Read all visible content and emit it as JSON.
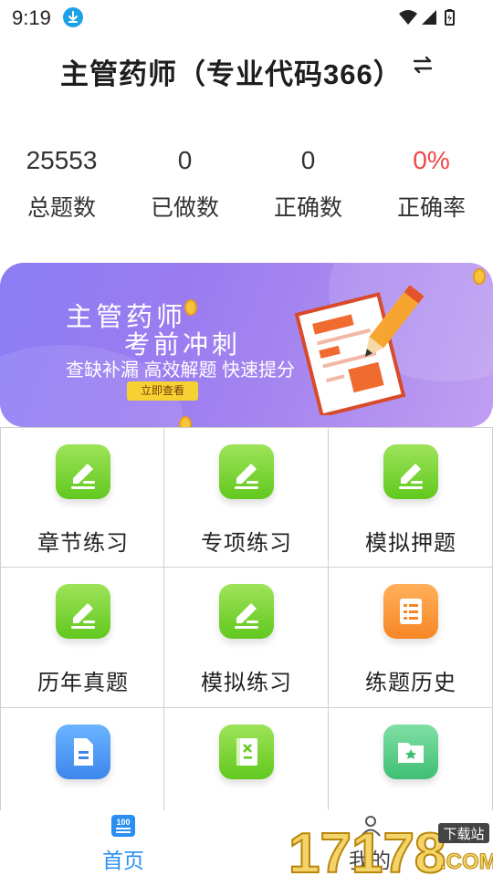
{
  "status_bar": {
    "time": "9:19"
  },
  "header": {
    "title": "主管药师（专业代码366）"
  },
  "stats": [
    {
      "value": "25553",
      "label": "总题数",
      "color": "#333333"
    },
    {
      "value": "0",
      "label": "已做数",
      "color": "#333333"
    },
    {
      "value": "0",
      "label": "正确数",
      "color": "#333333"
    },
    {
      "value": "0%",
      "label": "正确率",
      "color": "#f04747"
    }
  ],
  "banner": {
    "line1": "主管药师",
    "line2": "考前冲刺",
    "subtitle": "查缺补漏 高效解题 快速提分",
    "button": "立即查看"
  },
  "grid": [
    {
      "label": "章节练习",
      "icon": "pencil-edit-icon",
      "color": "green"
    },
    {
      "label": "专项练习",
      "icon": "pencil-edit-icon",
      "color": "green"
    },
    {
      "label": "模拟押题",
      "icon": "pencil-edit-icon",
      "color": "green"
    },
    {
      "label": "历年真题",
      "icon": "pencil-edit-icon",
      "color": "green"
    },
    {
      "label": "模拟练习",
      "icon": "pencil-edit-icon",
      "color": "green"
    },
    {
      "label": "练题历史",
      "icon": "scroll-list-icon",
      "color": "orange"
    },
    {
      "label": "",
      "icon": "document-icon",
      "color": "blue"
    },
    {
      "label": "",
      "icon": "wrong-book-icon",
      "color": "green"
    },
    {
      "label": "",
      "icon": "star-folder-icon",
      "color": "teal"
    }
  ],
  "bottom_nav": {
    "home_badge": "100",
    "home_label": "首页",
    "mine_label": "我的",
    "active_color": "#2a8ff0"
  },
  "watermark": {
    "number": "17178",
    "site": ".COM",
    "tag": "下载站"
  }
}
